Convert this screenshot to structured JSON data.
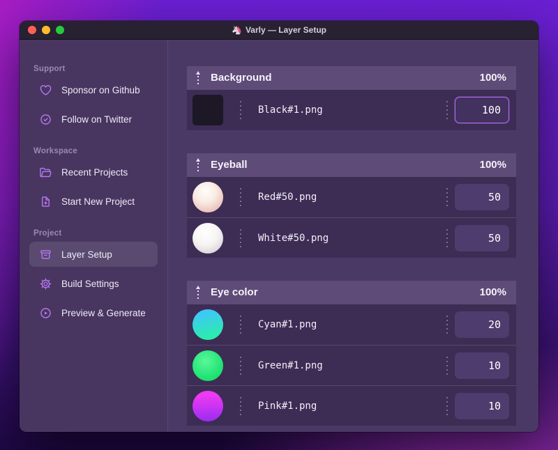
{
  "window": {
    "title": "Varly — Layer Setup",
    "app_icon": "🦄"
  },
  "sidebar": {
    "sections": [
      {
        "label": "Support",
        "items": [
          {
            "icon": "heart-icon",
            "label": "Sponsor on Github"
          },
          {
            "icon": "badge-check-icon",
            "label": "Follow on Twitter"
          }
        ]
      },
      {
        "label": "Workspace",
        "items": [
          {
            "icon": "folder-icon",
            "label": "Recent Projects"
          },
          {
            "icon": "file-plus-icon",
            "label": "Start New Project"
          }
        ]
      },
      {
        "label": "Project",
        "items": [
          {
            "icon": "archive-box-icon",
            "label": "Layer Setup",
            "active": "true"
          },
          {
            "icon": "gear-icon",
            "label": "Build Settings"
          },
          {
            "icon": "play-circle-icon",
            "label": "Preview & Generate"
          }
        ]
      }
    ]
  },
  "layers": {
    "groups": [
      {
        "name": "Background",
        "weight": "100%",
        "items": [
          {
            "file": "Black#1.png",
            "value": "100",
            "thumb": "black-square",
            "focused": "true"
          }
        ]
      },
      {
        "name": "Eyeball",
        "weight": "100%",
        "items": [
          {
            "file": "Red#50.png",
            "value": "50",
            "thumb": "red-sphere"
          },
          {
            "file": "White#50.png",
            "value": "50",
            "thumb": "white-sphere"
          }
        ]
      },
      {
        "name": "Eye color",
        "weight": "100%",
        "items": [
          {
            "file": "Cyan#1.png",
            "value": "20",
            "thumb": "cyan-circle"
          },
          {
            "file": "Green#1.png",
            "value": "10",
            "thumb": "green-circle"
          },
          {
            "file": "Pink#1.png",
            "value": "10",
            "thumb": "pink-circle"
          }
        ]
      }
    ]
  },
  "colors": {
    "accent": "#b06df2",
    "sidebar_icon": "#bb79f8",
    "titlebar_bg": "#272131",
    "sidebar_bg": "#483660",
    "content_bg": "#4b3965",
    "group_header_bg": "#5e4b78",
    "row_bg": "#3d2c54",
    "traffic_close": "#ff5f57",
    "traffic_minimize": "#febc2e",
    "traffic_zoom": "#28c840"
  }
}
